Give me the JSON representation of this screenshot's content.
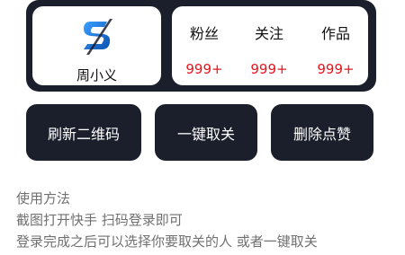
{
  "profile": {
    "username": "周小义",
    "logo_icon": "s-logo-icon"
  },
  "stats": [
    {
      "label": "粉丝",
      "value": "999+"
    },
    {
      "label": "关注",
      "value": "999+"
    },
    {
      "label": "作品",
      "value": "999+"
    }
  ],
  "buttons": {
    "refresh_qr": "刷新二维码",
    "one_click_unfollow": "一键取关",
    "delete_likes": "删除点赞"
  },
  "instructions": {
    "title": "使用方法",
    "line1": "截图打开快手 扫码登录即可",
    "line2": "登录完成之后可以选择你要取关的人 或者一键取关"
  },
  "colors": {
    "dark_panel": "#1b1e2b",
    "stat_value": "#e8141b",
    "instruction_text": "#707070",
    "logo_blue": "#1e73d6"
  }
}
